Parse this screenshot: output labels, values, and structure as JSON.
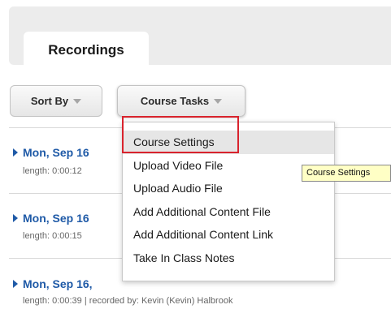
{
  "tabs": [
    {
      "label": "Recordings",
      "active": true
    }
  ],
  "toolbar": {
    "sort_label": "Sort By",
    "tasks_label": "Course Tasks"
  },
  "recordings": [
    {
      "title": "Mon, Sep 16",
      "meta": "length: 0:00:12"
    },
    {
      "title": "Mon, Sep 16",
      "meta": "length: 0:00:15"
    },
    {
      "title": "Mon, Sep 16,",
      "meta": "length: 0:00:39 | recorded by: Kevin (Kevin) Halbrook"
    }
  ],
  "course_tasks_menu": {
    "items": [
      {
        "label": "Course Settings",
        "highlighted": true
      },
      {
        "label": "Upload Video File"
      },
      {
        "label": "Upload Audio File"
      },
      {
        "label": "Add Additional Content File"
      },
      {
        "label": "Add Additional Content Link"
      },
      {
        "label": "Take In Class Notes"
      }
    ]
  },
  "tooltip": {
    "text": "Course Settings"
  },
  "colors": {
    "link_blue": "#1f5aa7",
    "highlight_border": "#d9232d",
    "tooltip_bg": "#ffffc5"
  },
  "icons": {
    "sort_caret": "chevron-down-icon",
    "tasks_caret": "chevron-down-icon",
    "expand": "triangle-right-icon"
  }
}
